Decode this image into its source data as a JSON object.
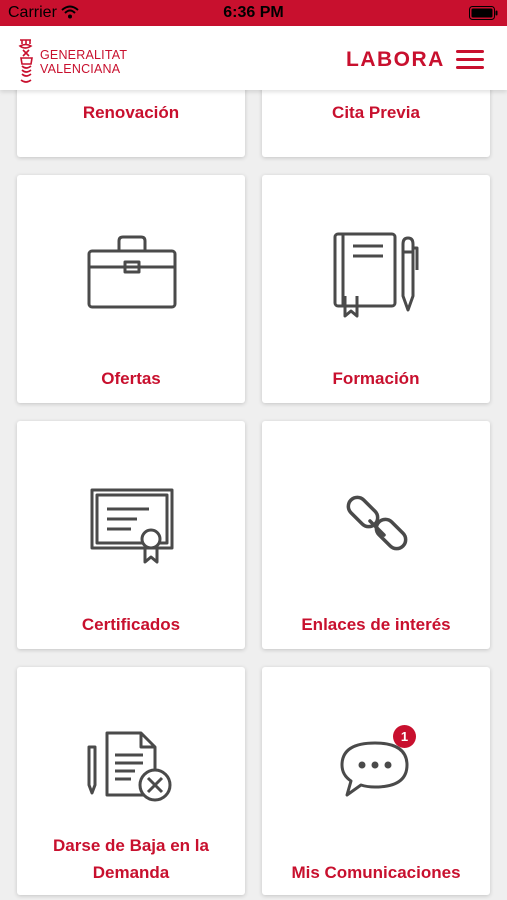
{
  "status_bar": {
    "carrier": "Carrier",
    "time": "6:36 PM",
    "wifi_icon": "wifi-icon",
    "battery_icon": "battery-icon"
  },
  "header": {
    "logo_line1": "GENERALITAT",
    "logo_line2": "VALENCIANA",
    "brand": "LABORA",
    "menu_icon": "hamburger-menu-icon"
  },
  "tiles": [
    {
      "label": "Renovación",
      "icon": "renewal"
    },
    {
      "label": "Cita Previa",
      "icon": "appointment"
    },
    {
      "label": "Ofertas",
      "icon": "briefcase-icon"
    },
    {
      "label": "Formación",
      "icon": "notebook-pencil-icon"
    },
    {
      "label": "Certificados",
      "icon": "certificate-icon"
    },
    {
      "label": "Enlaces de interés",
      "icon": "link-icon"
    },
    {
      "label_line1": "Darse de Baja en la",
      "label_line2": "Demanda",
      "icon": "document-cancel-icon"
    },
    {
      "label": "Mis Comunicaciones",
      "icon": "chat-bubble-icon",
      "badge": "1"
    }
  ],
  "colors": {
    "accent": "#c8102e",
    "background": "#efefef",
    "icon_stroke": "#4a4a4a"
  }
}
